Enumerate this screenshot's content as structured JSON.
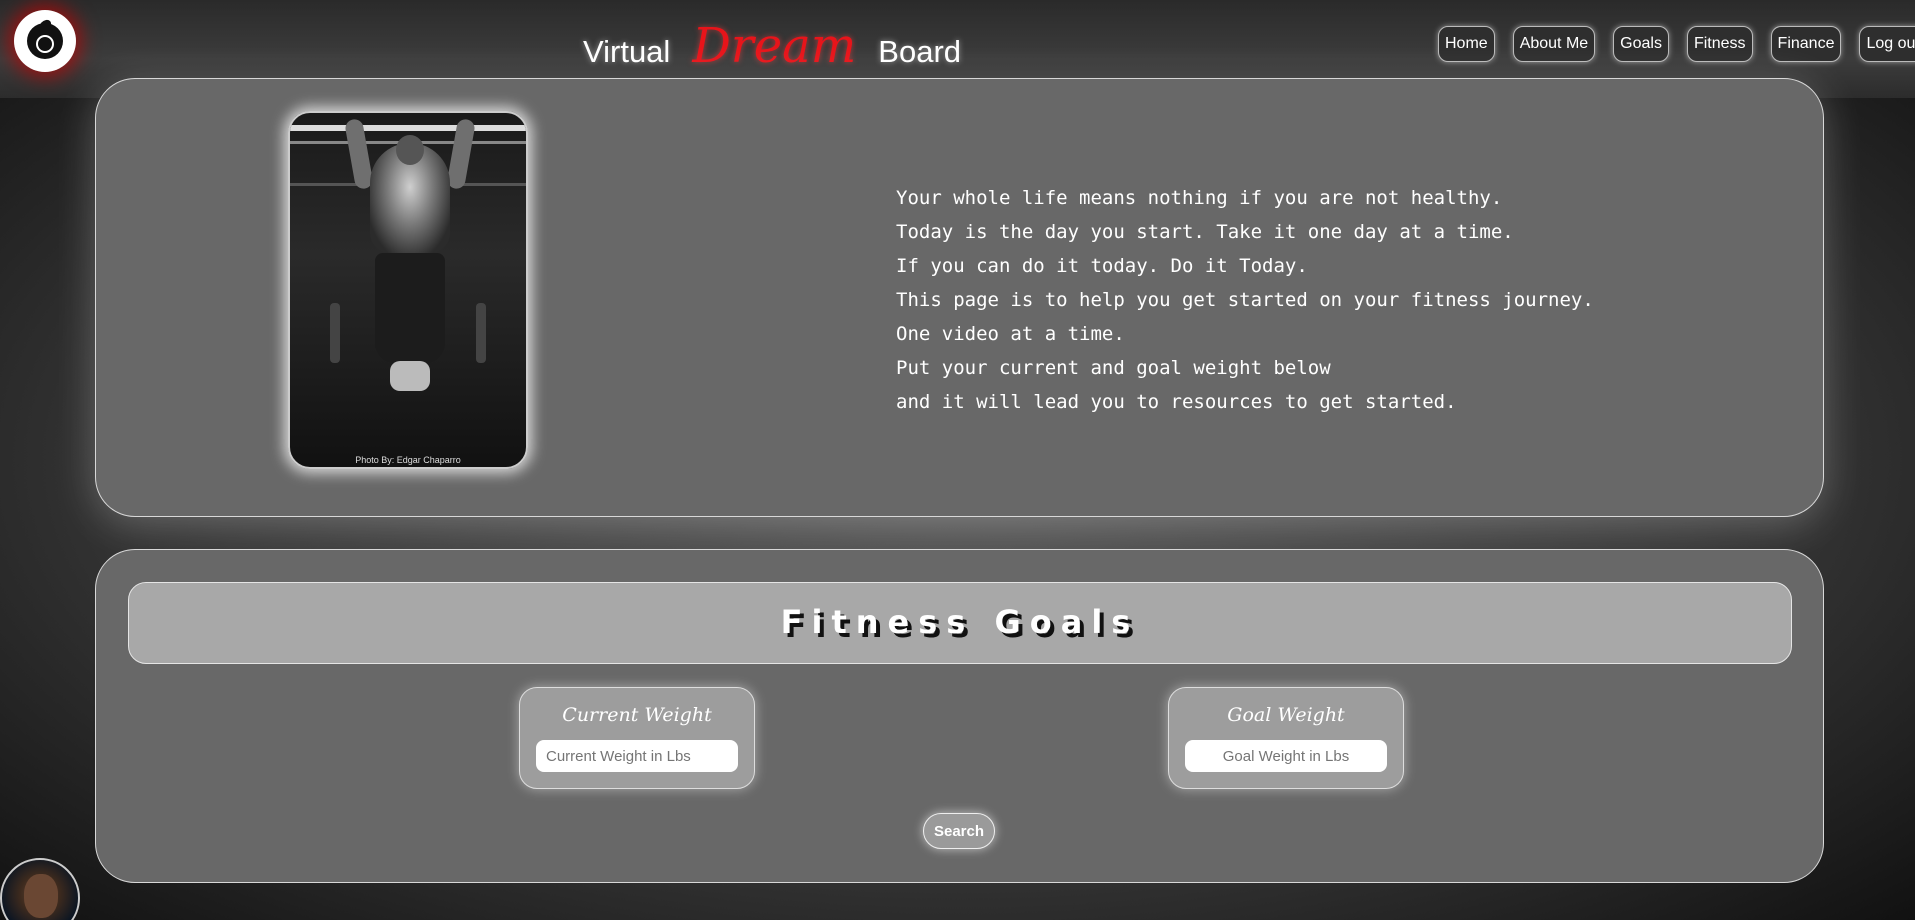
{
  "header": {
    "brand_left": "Virtual",
    "brand_mid": "Dream",
    "brand_right": "Board",
    "nav": [
      "Home",
      "About Me",
      "Goals",
      "Fitness",
      "Finance",
      "Log out"
    ]
  },
  "hero": {
    "photo_credit": "Photo By: Edgar Chaparro",
    "lines": [
      "Your whole life means nothing if you are not healthy.",
      "Today is the day you start. Take it one day at a time.",
      "If you can do it today. Do it Today.",
      "This page is to help you get started on your fitness journey.",
      "One video at a time.",
      "Put your current and goal weight below",
      "and it will lead you to resources to get started."
    ]
  },
  "goals": {
    "title": "Fitness Goals",
    "current_label": "Current Weight",
    "current_placeholder": "Current Weight in Lbs",
    "goal_label": "Goal Weight",
    "goal_placeholder": "Goal Weight in Lbs",
    "search_label": "Search"
  },
  "colors": {
    "accent_red": "#e8141a",
    "panel": "#686868",
    "goals_bar": "#a8a8a8"
  }
}
